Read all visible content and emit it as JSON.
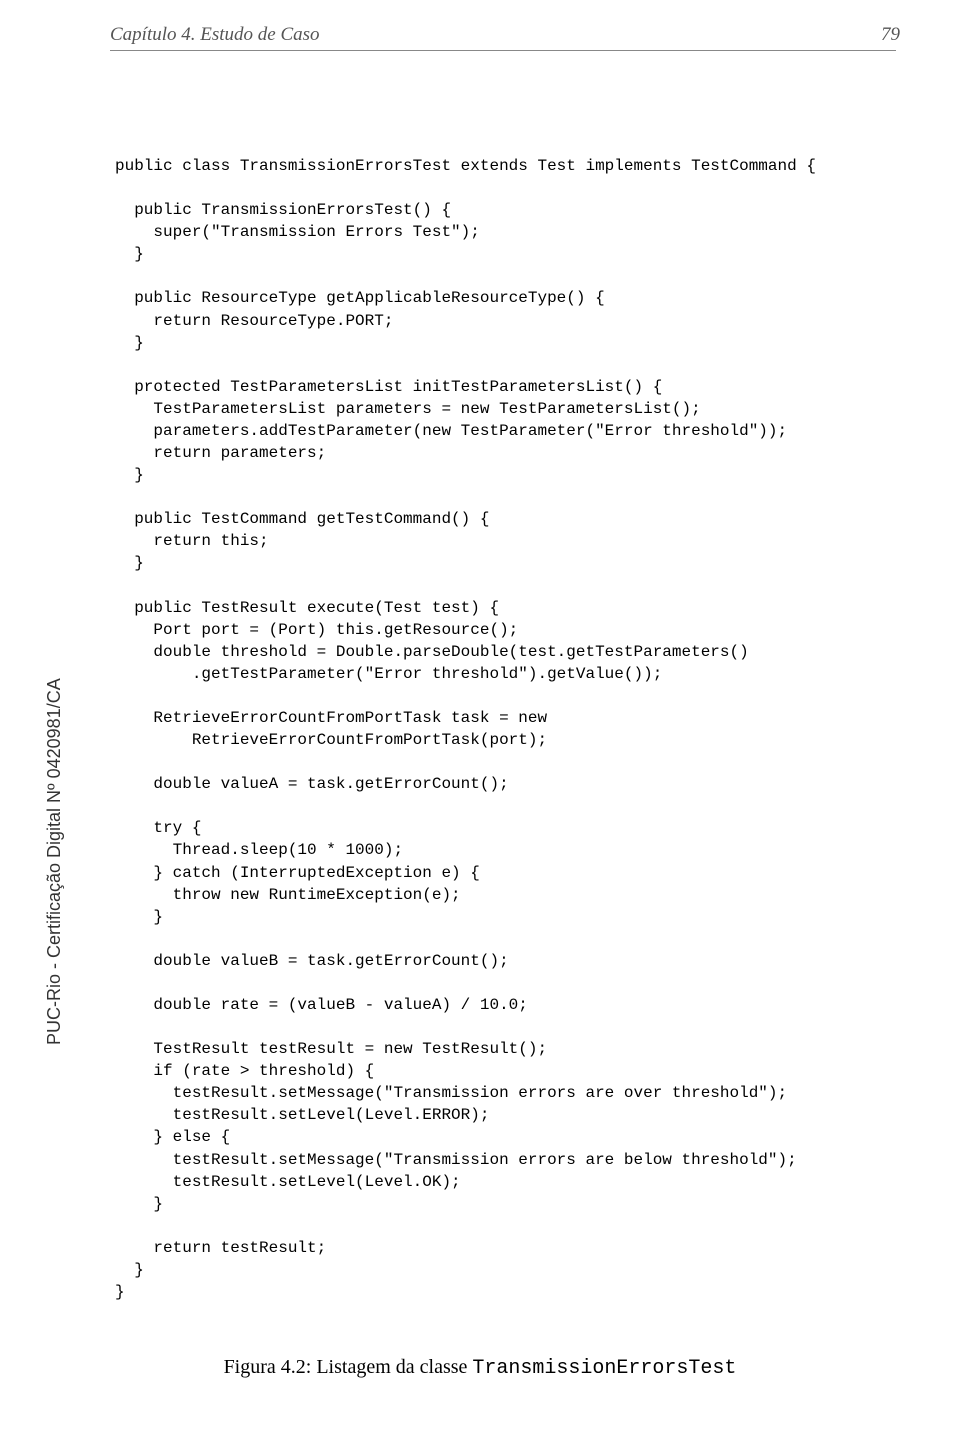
{
  "header": {
    "left": "Capítulo 4. Estudo de Caso",
    "right": "79"
  },
  "sidebar": "PUC-Rio - Certificação Digital Nº 0420981/CA",
  "code": "public class TransmissionErrorsTest extends Test implements TestCommand {\n\n  public TransmissionErrorsTest() {\n    super(\"Transmission Errors Test\");\n  }\n\n  public ResourceType getApplicableResourceType() {\n    return ResourceType.PORT;\n  }\n\n  protected TestParametersList initTestParametersList() {\n    TestParametersList parameters = new TestParametersList();\n    parameters.addTestParameter(new TestParameter(\"Error threshold\"));\n    return parameters;\n  }\n\n  public TestCommand getTestCommand() {\n    return this;\n  }\n\n  public TestResult execute(Test test) {\n    Port port = (Port) this.getResource();\n    double threshold = Double.parseDouble(test.getTestParameters()\n        .getTestParameter(\"Error threshold\").getValue());\n\n    RetrieveErrorCountFromPortTask task = new\n        RetrieveErrorCountFromPortTask(port);\n\n    double valueA = task.getErrorCount();\n\n    try {\n      Thread.sleep(10 * 1000);\n    } catch (InterruptedException e) {\n      throw new RuntimeException(e);\n    }\n\n    double valueB = task.getErrorCount();\n\n    double rate = (valueB - valueA) / 10.0;\n\n    TestResult testResult = new TestResult();\n    if (rate > threshold) {\n      testResult.setMessage(\"Transmission errors are over threshold\");\n      testResult.setLevel(Level.ERROR);\n    } else {\n      testResult.setMessage(\"Transmission errors are below threshold\");\n      testResult.setLevel(Level.OK);\n    }\n\n    return testResult;\n  }\n}",
  "caption": {
    "prefix": "Figura 4.2: Listagem da classe ",
    "classname": "TransmissionErrorsTest"
  }
}
